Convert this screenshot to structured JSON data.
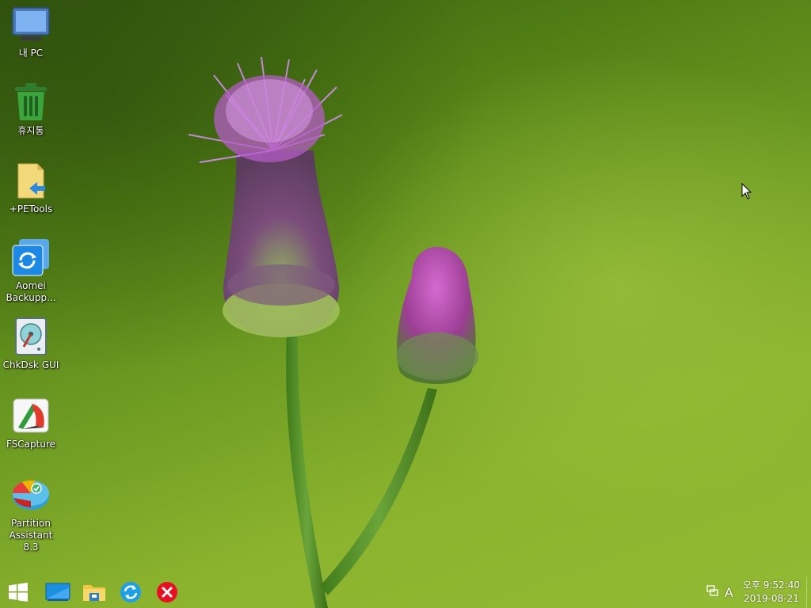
{
  "desktop": {
    "icons": [
      {
        "id": "my-pc",
        "label": "내 PC",
        "icon": "monitor-icon"
      },
      {
        "id": "recycle-bin",
        "label": "휴지통",
        "icon": "recycle-bin-icon"
      },
      {
        "id": "petools",
        "label": "+PETools",
        "icon": "shortcut-folder-icon"
      },
      {
        "id": "aomei-backupper",
        "label": "Aomei\nBackupp...",
        "icon": "aomei-backupper-icon"
      },
      {
        "id": "chkdsk-gui",
        "label": "ChkDsk GUI",
        "icon": "disk-check-icon"
      },
      {
        "id": "fscapture",
        "label": "FSCapture",
        "icon": "fscapture-icon"
      },
      {
        "id": "partition-assistant",
        "label": "Partition\nAssistant 8.3",
        "icon": "partition-assistant-icon"
      }
    ]
  },
  "taskbar": {
    "start": {
      "icon": "windows-logo-icon"
    },
    "pinned": [
      {
        "id": "desktop-view",
        "icon": "monitor-screen-icon"
      },
      {
        "id": "file-explorer",
        "icon": "folder-icon"
      },
      {
        "id": "refresh",
        "icon": "refresh-icon"
      },
      {
        "id": "close-shutdown",
        "icon": "red-x-icon"
      }
    ],
    "tray": {
      "network_icon": "network-icon",
      "ime_label": "A",
      "time": "오후 9:52:40",
      "date": "2019-08-21"
    }
  },
  "colors": {
    "accent_blue": "#1e90ff",
    "close_red": "#e81123",
    "recycle_green": "#3aa53a"
  }
}
